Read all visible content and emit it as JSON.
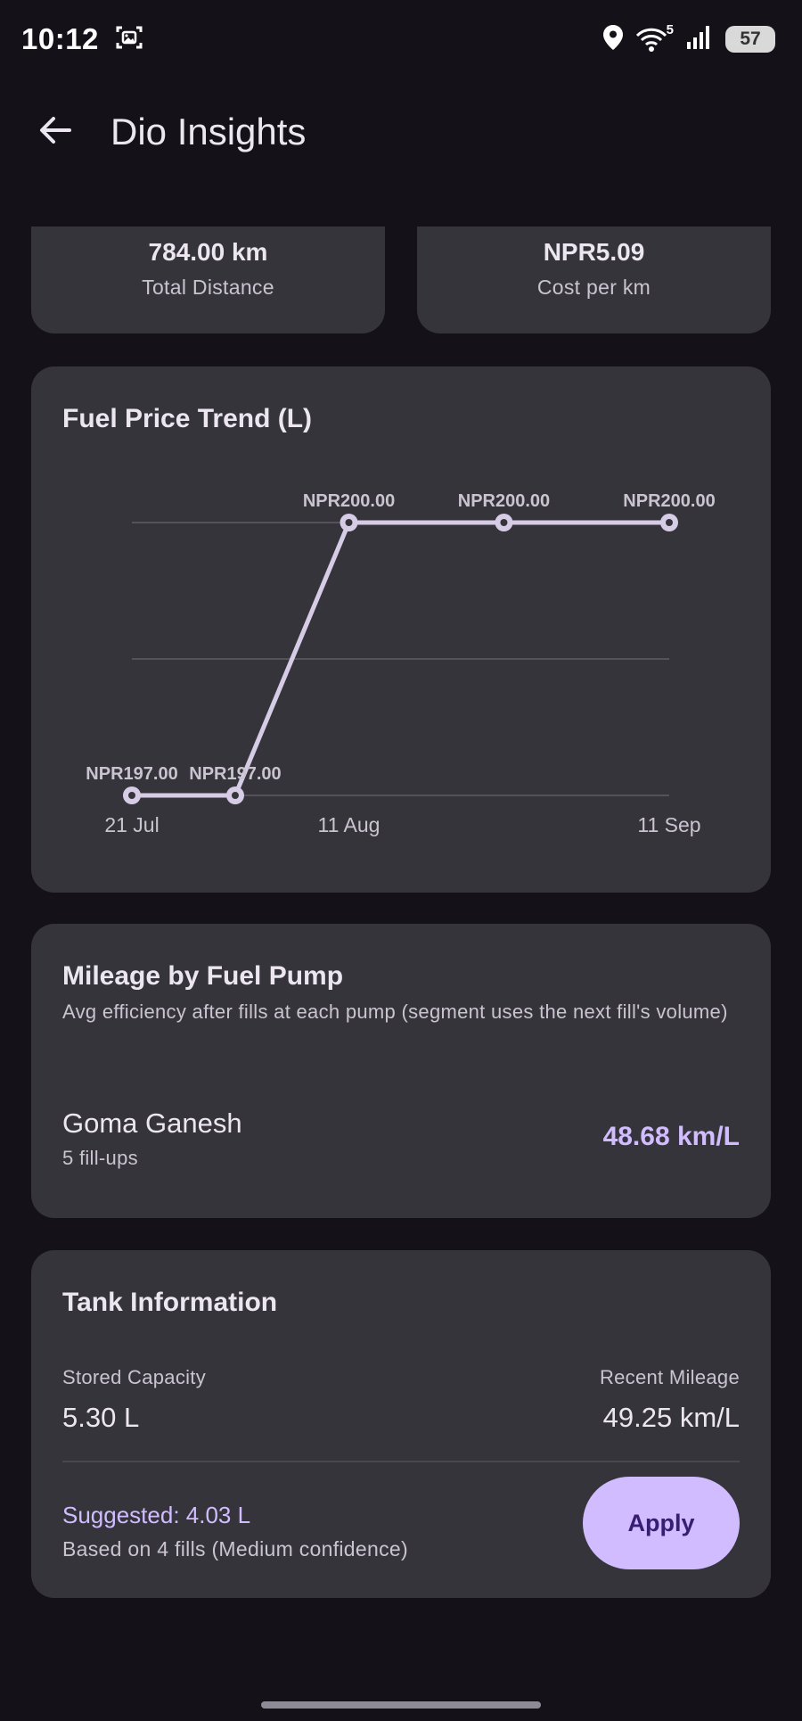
{
  "status_bar": {
    "time": "10:12",
    "wifi_badge": "5",
    "battery": "57"
  },
  "app_bar": {
    "title": "Dio Insights"
  },
  "stats": [
    {
      "value": "784.00 km",
      "label": "Total Distance"
    },
    {
      "value": "NPR5.09",
      "label": "Cost per km"
    }
  ],
  "fuel_price_card": {
    "title": "Fuel Price Trend (L)"
  },
  "chart_data": {
    "type": "line",
    "title": "Fuel Price Trend (L)",
    "x_tick_labels": [
      "21 Jul",
      "11 Aug",
      "11 Sep"
    ],
    "series": [
      {
        "points": [
          {
            "x": "2025-07-21",
            "y": 197.0,
            "label": "NPR197.00"
          },
          {
            "x": "2025-07-31",
            "y": 197.0,
            "label": "NPR197.00"
          },
          {
            "x": "2025-08-11",
            "y": 200.0,
            "label": "NPR200.00"
          },
          {
            "x": "2025-08-26",
            "y": 200.0,
            "label": "NPR200.00"
          },
          {
            "x": "2025-09-11",
            "y": 200.0,
            "label": "NPR200.00"
          }
        ]
      }
    ],
    "ylim": [
      197,
      200
    ],
    "xlim": [
      "2025-07-21",
      "2025-09-11"
    ],
    "grid": true,
    "line_color": "#D6CCE6"
  },
  "pump_card": {
    "title": "Mileage by Fuel Pump",
    "subtitle": "Avg efficiency after fills at each pump (segment uses the next fill's volume)",
    "pumps": [
      {
        "name": "Goma Ganesh",
        "fills": "5 fill-ups",
        "efficiency": "48.68 km/L"
      }
    ]
  },
  "tank_card": {
    "title": "Tank Information",
    "stored_label": "Stored Capacity",
    "stored_value": "5.30 L",
    "recent_label": "Recent Mileage",
    "recent_value": "49.25 km/L",
    "suggested": "Suggested: 4.03 L",
    "based_on": "Based on 4 fills (Medium confidence)",
    "apply_label": "Apply"
  },
  "colors": {
    "background": "#141218",
    "card": "#36343B",
    "accent": "#D0BCFF"
  }
}
